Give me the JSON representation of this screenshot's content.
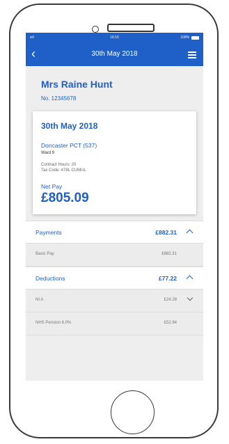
{
  "status_bar": {
    "signal": "atl",
    "time": "16:15",
    "battery": "100%"
  },
  "nav": {
    "back_icon": "chevron-left-icon",
    "title": "30th May 2018",
    "menu_icon": "hamburger-menu-icon"
  },
  "employee": {
    "name": "Mrs Raine Hunt",
    "number": "No. 12345678"
  },
  "payslip": {
    "date": "30th May 2018",
    "employer": "Doncaster PCT (537)",
    "ward": "Ward 9",
    "contract_hours": "Contract Hours: 20",
    "tax_code": "Tax Code: 478L CUMUL",
    "net_pay_label": "Net Pay",
    "net_pay_value": "£805.09"
  },
  "payments": {
    "title": "Payments",
    "total": "£882.31",
    "items": [
      {
        "label": "Basic Pay",
        "amount": "£882.31"
      }
    ]
  },
  "deductions": {
    "title": "Deductions",
    "total": "£77.22",
    "items": [
      {
        "label": "NI A",
        "amount": "£24.28"
      },
      {
        "label": "NHS Pension 6.0%",
        "amount": "£52.94"
      }
    ]
  },
  "colors": {
    "brand_blue": "#1f5fc8",
    "background": "#eeeeee"
  }
}
